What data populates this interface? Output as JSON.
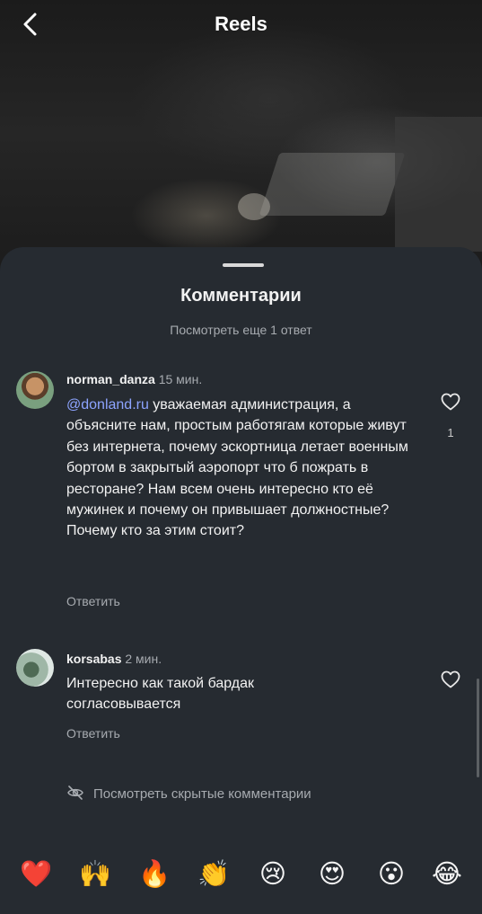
{
  "header": {
    "title": "Reels",
    "back_icon": "chevron-left-icon"
  },
  "sheet": {
    "title": "Комментарии",
    "more_replies": "Посмотреть еще 1 ответ"
  },
  "comments": [
    {
      "username": "norman_danza",
      "time": "15 мин.",
      "mention": "@donland.ru",
      "text": " уважаемая администрация, а объясните нам, простым работягам которые живут без интернета, почему эскортница летает военным бортом в закрытый аэропорт что б пожрать в ресторане? Нам всем очень интересно кто её мужинек и почему он привышает должностные? Почему кто за этим стоит?",
      "reply_label": "Ответить",
      "likes": "1",
      "like_icon": "heart-icon"
    },
    {
      "username": "korsabas",
      "time": "2 мин.",
      "mention": "",
      "text": "Интересно как такой бардак согласовывается",
      "reply_label": "Ответить",
      "like_icon": "heart-icon"
    }
  ],
  "hidden_comments": {
    "label": "Посмотреть скрытые комментарии",
    "icon": "eye-off-icon"
  },
  "reactions": [
    {
      "emoji": "❤️",
      "name": "heart"
    },
    {
      "emoji": "🙌",
      "name": "raised-hands"
    },
    {
      "emoji": "🔥",
      "name": "fire"
    },
    {
      "emoji": "👏",
      "name": "clapping-hands"
    },
    {
      "emoji": "😢",
      "name": "crying-face"
    },
    {
      "emoji": "😍",
      "name": "heart-eyes"
    },
    {
      "emoji": "😮",
      "name": "surprised-face"
    },
    {
      "emoji": "😂",
      "name": "tears-of-joy"
    }
  ],
  "colors": {
    "sheet_background": "#262b31",
    "mention": "#8da4ff",
    "secondary_text": "#a7abb0"
  }
}
